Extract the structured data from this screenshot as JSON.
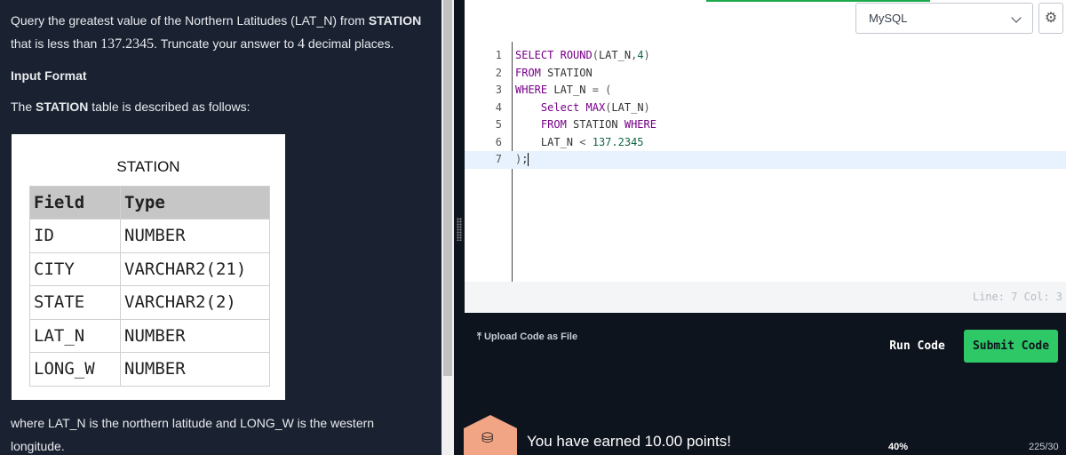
{
  "problem": {
    "line1_pre": "Query the greatest value of the Northern Latitudes (LAT_N) from ",
    "line1_bold": "STATION",
    "line2_pre": "that is less than ",
    "line2_value": "137.2345",
    "line2_mid": ". Truncate your answer to ",
    "line2_digits": "4",
    "line2_post": " decimal places.",
    "input_format_heading": "Input Format",
    "desc_pre": "The ",
    "desc_bold": "STATION",
    "desc_post": " table is described as follows:",
    "footer_line1": "where LAT_N is the northern latitude and LONG_W is the western",
    "footer_line2": "longitude."
  },
  "station_table": {
    "caption": "STATION",
    "headers": [
      "Field",
      "Type"
    ],
    "rows": [
      [
        "ID",
        "NUMBER"
      ],
      [
        "CITY",
        "VARCHAR2(21)"
      ],
      [
        "STATE",
        "VARCHAR2(2)"
      ],
      [
        "LAT_N",
        "NUMBER"
      ],
      [
        "LONG_W",
        "NUMBER"
      ]
    ]
  },
  "editor": {
    "language": "MySQL",
    "line_numbers": [
      "1",
      "2",
      "3",
      "4",
      "5",
      "6",
      "7"
    ],
    "position_label": "Line: 7 Col: 3"
  },
  "actions": {
    "upload_label": "Upload Code as File",
    "run_label": "Run Code",
    "submit_label": "Submit Code"
  },
  "result": {
    "earned_message": "You have earned 10.00 points!",
    "progress_percent": "40%",
    "score": "225/30"
  },
  "colors": {
    "submit_green": "#2ec866",
    "panel_dark": "#1a2231",
    "page_dark": "#0e141e",
    "badge": "#f2a585"
  },
  "icons": [
    "upload-icon",
    "chevron-down-icon",
    "gear-icon",
    "database-icon"
  ]
}
